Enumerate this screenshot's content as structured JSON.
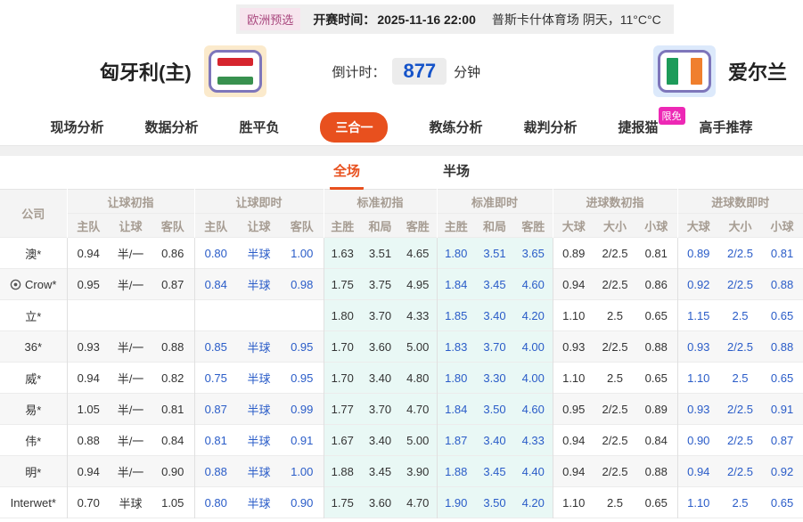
{
  "colors": {
    "accent": "#e8501e",
    "live_odds_blue": "#2a5cc8",
    "countdown_blue": "#1553c9",
    "free_badge_magenta": "#ed28b5",
    "standard_tint": "#e9f8f5"
  },
  "top_bar": {
    "league_badge": "欧洲预选",
    "kickoff_label": "开赛时间：",
    "kickoff_time": "2025-11-16 22:00",
    "venue_weather": "普斯卡什体育场  阴天，11°C°C"
  },
  "header": {
    "home_team": "匈牙利(主)",
    "away_team": "爱尔兰",
    "home_flag": "hungary-flag",
    "away_flag": "ireland-flag",
    "countdown_label": "倒计时：",
    "countdown_value": "877",
    "countdown_unit": "分钟"
  },
  "nav": {
    "items": [
      {
        "label": "现场分析",
        "active": false
      },
      {
        "label": "数据分析",
        "active": false
      },
      {
        "label": "胜平负",
        "active": false
      },
      {
        "label": "三合一",
        "active": true
      },
      {
        "label": "教练分析",
        "active": false
      },
      {
        "label": "裁判分析",
        "active": false
      },
      {
        "label": "捷报猫",
        "active": false,
        "badge": "限免"
      },
      {
        "label": "高手推荐",
        "active": false
      }
    ]
  },
  "period_tabs": [
    {
      "label": "全场",
      "active": true
    },
    {
      "label": "半场",
      "active": false
    }
  ],
  "odds_table": {
    "company_header": "公司",
    "groups": [
      {
        "label": "让球初指",
        "cols": [
          "主队",
          "让球",
          "客队"
        ],
        "live": false,
        "tint": false
      },
      {
        "label": "让球即时",
        "cols": [
          "主队",
          "让球",
          "客队"
        ],
        "live": true,
        "tint": false
      },
      {
        "label": "标准初指",
        "cols": [
          "主胜",
          "和局",
          "客胜"
        ],
        "live": false,
        "tint": true
      },
      {
        "label": "标准即时",
        "cols": [
          "主胜",
          "和局",
          "客胜"
        ],
        "live": true,
        "tint": true
      },
      {
        "label": "进球数初指",
        "cols": [
          "大球",
          "大小",
          "小球"
        ],
        "live": false,
        "tint": false
      },
      {
        "label": "进球数即时",
        "cols": [
          "大球",
          "大小",
          "小球"
        ],
        "live": true,
        "tint": false
      }
    ],
    "rows": [
      {
        "company": "澳*",
        "icon": false,
        "cells": [
          [
            "0.94",
            "半/一",
            "0.86"
          ],
          [
            "0.80",
            "半球",
            "1.00"
          ],
          [
            "1.63",
            "3.51",
            "4.65"
          ],
          [
            "1.80",
            "3.51",
            "3.65"
          ],
          [
            "0.89",
            "2/2.5",
            "0.81"
          ],
          [
            "0.89",
            "2/2.5",
            "0.81"
          ]
        ]
      },
      {
        "company": "Crow*",
        "icon": true,
        "cells": [
          [
            "0.95",
            "半/一",
            "0.87"
          ],
          [
            "0.84",
            "半球",
            "0.98"
          ],
          [
            "1.75",
            "3.75",
            "4.95"
          ],
          [
            "1.84",
            "3.45",
            "4.60"
          ],
          [
            "0.94",
            "2/2.5",
            "0.86"
          ],
          [
            "0.92",
            "2/2.5",
            "0.88"
          ]
        ]
      },
      {
        "company": "立*",
        "icon": false,
        "cells": [
          [
            "",
            "",
            ""
          ],
          [
            "",
            "",
            ""
          ],
          [
            "1.80",
            "3.70",
            "4.33"
          ],
          [
            "1.85",
            "3.40",
            "4.20"
          ],
          [
            "1.10",
            "2.5",
            "0.65"
          ],
          [
            "1.15",
            "2.5",
            "0.65"
          ]
        ]
      },
      {
        "company": "36*",
        "icon": false,
        "cells": [
          [
            "0.93",
            "半/一",
            "0.88"
          ],
          [
            "0.85",
            "半球",
            "0.95"
          ],
          [
            "1.70",
            "3.60",
            "5.00"
          ],
          [
            "1.83",
            "3.70",
            "4.00"
          ],
          [
            "0.93",
            "2/2.5",
            "0.88"
          ],
          [
            "0.93",
            "2/2.5",
            "0.88"
          ]
        ]
      },
      {
        "company": "威*",
        "icon": false,
        "cells": [
          [
            "0.94",
            "半/一",
            "0.82"
          ],
          [
            "0.75",
            "半球",
            "0.95"
          ],
          [
            "1.70",
            "3.40",
            "4.80"
          ],
          [
            "1.80",
            "3.30",
            "4.00"
          ],
          [
            "1.10",
            "2.5",
            "0.65"
          ],
          [
            "1.10",
            "2.5",
            "0.65"
          ]
        ]
      },
      {
        "company": "易*",
        "icon": false,
        "cells": [
          [
            "1.05",
            "半/一",
            "0.81"
          ],
          [
            "0.87",
            "半球",
            "0.99"
          ],
          [
            "1.77",
            "3.70",
            "4.70"
          ],
          [
            "1.84",
            "3.50",
            "4.60"
          ],
          [
            "0.95",
            "2/2.5",
            "0.89"
          ],
          [
            "0.93",
            "2/2.5",
            "0.91"
          ]
        ]
      },
      {
        "company": "伟*",
        "icon": false,
        "cells": [
          [
            "0.88",
            "半/一",
            "0.84"
          ],
          [
            "0.81",
            "半球",
            "0.91"
          ],
          [
            "1.67",
            "3.40",
            "5.00"
          ],
          [
            "1.87",
            "3.40",
            "4.33"
          ],
          [
            "0.94",
            "2/2.5",
            "0.84"
          ],
          [
            "0.90",
            "2/2.5",
            "0.87"
          ]
        ]
      },
      {
        "company": "明*",
        "icon": false,
        "cells": [
          [
            "0.94",
            "半/一",
            "0.90"
          ],
          [
            "0.88",
            "半球",
            "1.00"
          ],
          [
            "1.88",
            "3.45",
            "3.90"
          ],
          [
            "1.88",
            "3.45",
            "4.40"
          ],
          [
            "0.94",
            "2/2.5",
            "0.88"
          ],
          [
            "0.94",
            "2/2.5",
            "0.92"
          ]
        ]
      },
      {
        "company": "Interwet*",
        "icon": false,
        "cells": [
          [
            "0.70",
            "半球",
            "1.05"
          ],
          [
            "0.80",
            "半球",
            "0.90"
          ],
          [
            "1.75",
            "3.60",
            "4.70"
          ],
          [
            "1.90",
            "3.50",
            "4.20"
          ],
          [
            "1.10",
            "2.5",
            "0.65"
          ],
          [
            "1.10",
            "2.5",
            "0.65"
          ]
        ]
      }
    ]
  }
}
